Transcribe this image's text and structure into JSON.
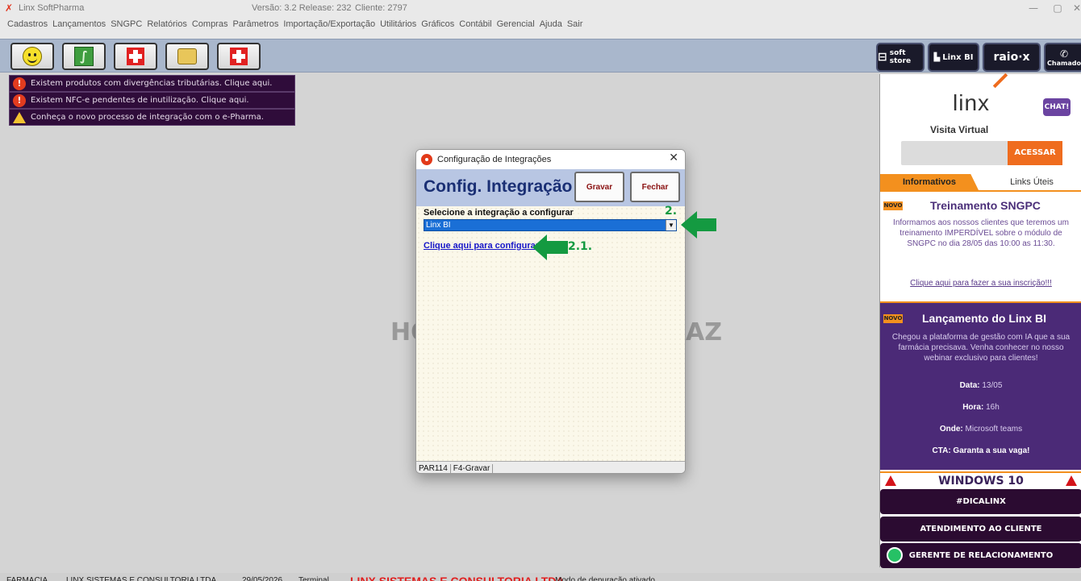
{
  "window": {
    "title": "Linx SoftPharma",
    "version": "Versão: 3.2 Release: 232",
    "client": "Cliente: 2797",
    "minimize": "—",
    "maximize": "▢",
    "close": "✕"
  },
  "menu": [
    "Cadastros",
    "Lançamentos",
    "SNGPC",
    "Relatórios",
    "Compras",
    "Parâmetros",
    "Importação/Exportação",
    "Utilitários",
    "Gráficos",
    "Contábil",
    "Gerencial",
    "Ajuda",
    "Sair"
  ],
  "toolbar": {
    "buttons": [
      "smiley-icon",
      "green-document-icon",
      "red-cross-icon",
      "box-icon",
      "red-cross-icon"
    ],
    "right": {
      "soft_store": "soft store",
      "linx_bi": "Linx BI",
      "raio_x": "raio·x",
      "chamado": "Chamado"
    }
  },
  "notifications": [
    {
      "icon": "error-icon",
      "text": "Existem produtos com divergências tributárias. Clique aqui."
    },
    {
      "icon": "error-icon",
      "text": "Existem NFC-e pendentes de inutilização. Clique aqui."
    },
    {
      "icon": "warning-icon",
      "text": "Conheça o novo processo de integração com o e-Pharma."
    }
  ],
  "background": {
    "watermark_left": "HO",
    "watermark_right": "AZ"
  },
  "dialog": {
    "title": "Configuração de Integrações",
    "close": "✕",
    "heading": "Config. Integração",
    "save_label": "Gravar",
    "close_label": "Fechar",
    "select_label": "Selecione a integração a configurar",
    "selected_value": "Linx BI",
    "dropdown_arrow": "▼",
    "config_link": "Clique aqui para configurar",
    "status_code": "PAR114",
    "status_hint": "F4-Gravar"
  },
  "annotations": {
    "step2": "2.",
    "step21": "2.1."
  },
  "right_panel": {
    "logo": "linx",
    "chat": "CHAT!",
    "visita_label": "Visita Virtual",
    "acessar": "ACESSAR",
    "tab_informativos": "Informativos",
    "tab_links": "Links Úteis",
    "badge_new": "NOVO",
    "news1": {
      "title": "Treinamento SNGPC",
      "body": "Informamos aos nossos clientes que teremos um treinamento IMPERDÍVEL sobre o módulo de SNGPC no dia 28/05 das 10:00 as 11:30.",
      "link": "Clique aqui para fazer a sua inscrição!!!"
    },
    "news2": {
      "title": "Lançamento do Linx BI",
      "body": "Chegou a plataforma de gestão com IA que a sua farmácia precisava. Venha conhecer no nosso webinar exclusivo para clientes!",
      "data_label": "Data:",
      "data_value": "13/05",
      "hora_label": "Hora:",
      "hora_value": "16h",
      "onde_label": "Onde:",
      "onde_value": "Microsoft teams",
      "cta": "CTA: Garanta a sua vaga!"
    },
    "windows_banner": "WINDOWS 10",
    "dicalinx": "#DICALINX",
    "atendimento": "ATENDIMENTO AO CLIENTE",
    "gerente": "GERENTE DE RELACIONAMENTO"
  },
  "statusbar": {
    "farmacia": "FARMACIA",
    "company": "LINX SISTEMAS E CONSULTORIA LTDA",
    "date": "29/05/2026",
    "terminal": "Terminal",
    "company_highlight": "LINX SISTEMAS E CONSULTORIA LTDA",
    "debug": "Modo de depuração ativado"
  },
  "colors": {
    "accent_orange": "#f3901e",
    "purple": "#4b2a77",
    "dialog_heading": "#1a2f74",
    "annotation_green": "#149a41"
  }
}
